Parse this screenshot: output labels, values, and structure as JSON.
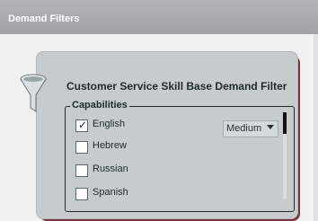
{
  "header": {
    "title": "Demand Filters"
  },
  "filter": {
    "title": "Customer Service Skill Base Demand Filter",
    "group_label": "Capabilities",
    "items": [
      {
        "label": "English",
        "checked": true,
        "level": "Medium"
      },
      {
        "label": "Hebrew",
        "checked": false
      },
      {
        "label": "Russian",
        "checked": false
      },
      {
        "label": "Spanish",
        "checked": false
      }
    ],
    "level_select": {
      "value": "Medium"
    }
  },
  "icons": {
    "filter": "funnel-icon",
    "dropdown": "chevron-down-icon"
  },
  "colors": {
    "card_background": "#c6cccd",
    "card_shadow": "#7a3438",
    "header": "#a5a9ac"
  }
}
